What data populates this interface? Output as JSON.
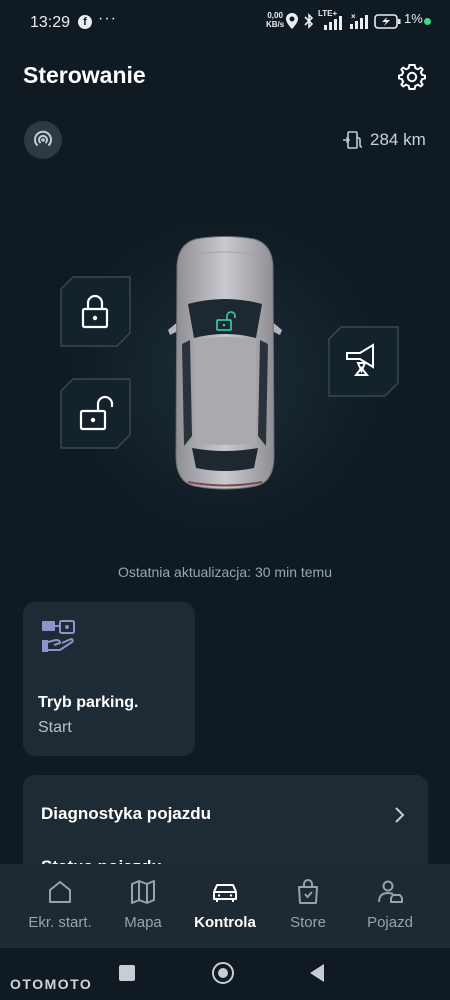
{
  "status": {
    "time": "13:29",
    "facebook_glyph": "f",
    "more_dots": "···",
    "data_rate": [
      "0,00",
      "KB/s"
    ],
    "network": "LTE+",
    "battery_percent": "1%",
    "icons": [
      "facebook-icon",
      "location-icon",
      "bluetooth-icon",
      "signal-icon",
      "battery-charging-icon"
    ]
  },
  "header": {
    "title": "Sterowanie"
  },
  "range": {
    "value": "284 km"
  },
  "car": {
    "last_update": "Ostatnia aktualizacja: 30 min temu",
    "lock_state_icon": "unlocked-icon",
    "accent_color": "#2fc4a0"
  },
  "parking_card": {
    "title": "Tryb parking.",
    "subtitle": "Start"
  },
  "list": {
    "items": [
      "Diagnostyka pojazdu",
      "Status pojazdu"
    ]
  },
  "bottom_nav": {
    "items": [
      {
        "label": "Ekr. start.",
        "icon": "home-icon"
      },
      {
        "label": "Mapa",
        "icon": "map-icon"
      },
      {
        "label": "Kontrola",
        "icon": "car-icon"
      },
      {
        "label": "Store",
        "icon": "store-icon"
      },
      {
        "label": "Pojazd",
        "icon": "user-car-icon"
      }
    ],
    "active_index": 2
  },
  "watermark": "OTOMOTO"
}
